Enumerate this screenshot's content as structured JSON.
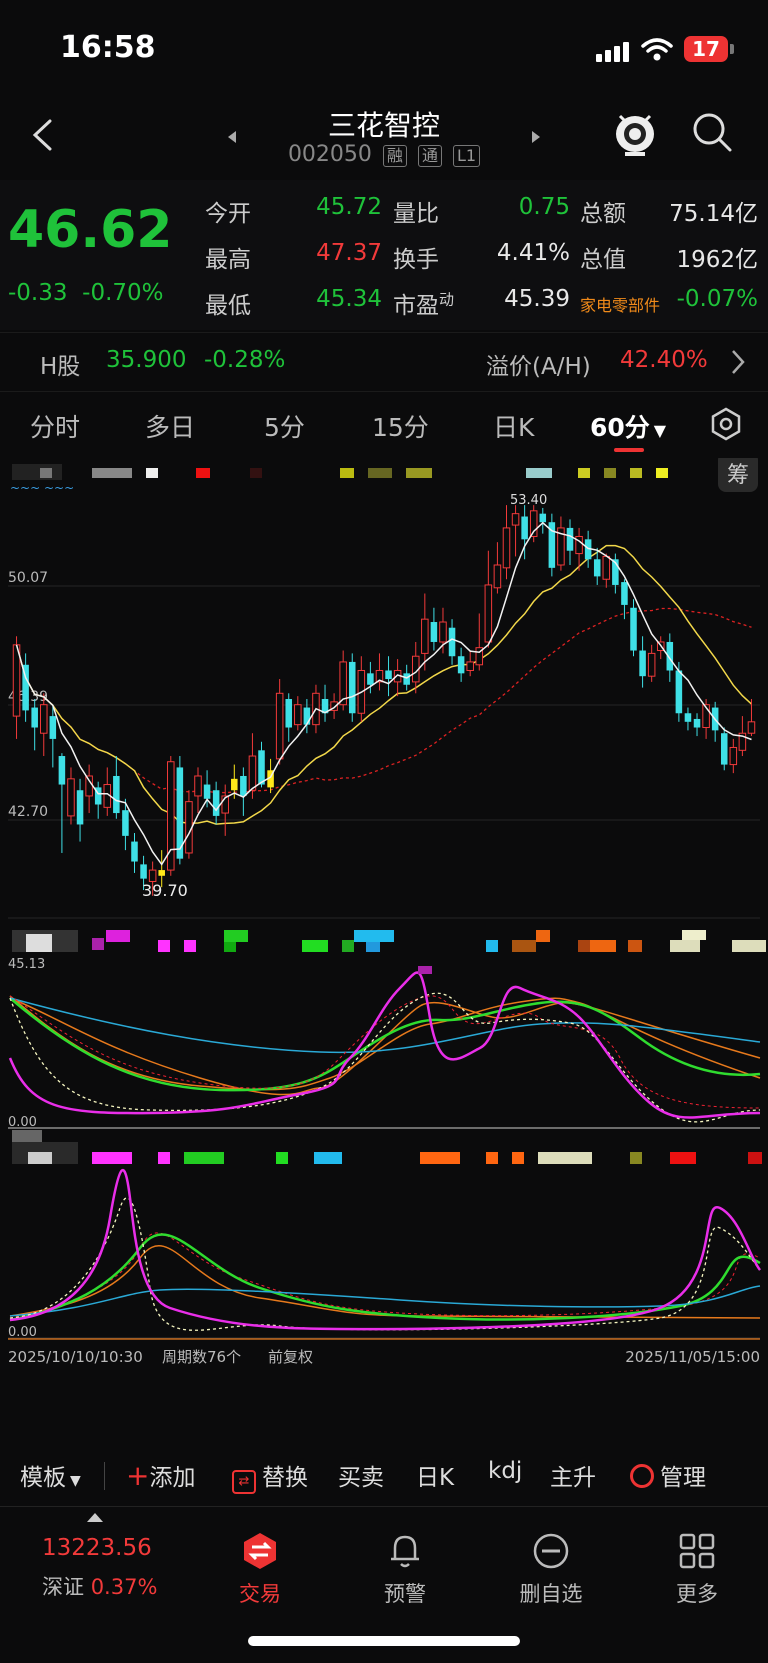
{
  "status_bar": {
    "time": "16:58",
    "battery": "17"
  },
  "header": {
    "title": "三花智控",
    "code": "002050",
    "tags": [
      "融",
      "通",
      "L1"
    ]
  },
  "quote": {
    "price": "46.62",
    "change": "-0.33",
    "change_pct": "-0.70%",
    "rows": [
      [
        {
          "k": "今开",
          "v": "45.72",
          "c": "g"
        },
        {
          "k": "量比",
          "v": "0.75",
          "c": "g"
        },
        {
          "k": "总额",
          "v": "75.14亿",
          "c": "w"
        }
      ],
      [
        {
          "k": "最高",
          "v": "47.37",
          "c": "r"
        },
        {
          "k": "换手",
          "v": "4.41%",
          "c": "w"
        },
        {
          "k": "总值",
          "v": "1962亿",
          "c": "w"
        }
      ],
      [
        {
          "k": "最低",
          "v": "45.34",
          "c": "g"
        },
        {
          "k": "市盈",
          "sup": "动",
          "v": "45.39",
          "c": "w"
        },
        {
          "k": "家电零部件",
          "v": "-0.07%",
          "c": "g"
        }
      ]
    ]
  },
  "hshare": {
    "label": "H股",
    "price": "35.900",
    "pct": "-0.28%",
    "premium_label": "溢价(A/H)",
    "premium": "42.40%"
  },
  "tabs": [
    "分时",
    "多日",
    "5分",
    "15分",
    "日K",
    "60分"
  ],
  "active_tab": "60分",
  "chips_label": "筹",
  "chart_data": {
    "type": "candlestick",
    "price_axis_labels": [
      "50.07",
      "46.39",
      "42.70"
    ],
    "low_marker": "39.70",
    "high_marker": "53.40",
    "start_label": "2025/10/10/10:30",
    "period_count": "周期数76个",
    "adjust": "前复权",
    "end_label": "2025/11/05/15:00",
    "indicator_zero_1": "0.00",
    "indicator_zero_2": "0.00",
    "indicator_top_1": "45.13",
    "candles": [
      [
        46,
        48.5,
        45.2,
        48.8
      ],
      [
        47.8,
        46.2,
        45.8,
        48.2
      ],
      [
        46.3,
        45.6,
        44.8,
        46.6
      ],
      [
        45.4,
        46.4,
        44.6,
        46.8
      ],
      [
        46,
        45.2,
        44.2,
        46.4
      ],
      [
        44.6,
        43.6,
        41.2,
        44.7
      ],
      [
        42.5,
        43.8,
        42.2,
        44.2
      ],
      [
        43.4,
        42.2,
        41.6,
        43.8
      ],
      [
        43.2,
        43.9,
        42.6,
        44.3
      ],
      [
        43.5,
        42.9,
        42.4,
        43.7
      ],
      [
        42.8,
        43.6,
        42.5,
        44.2
      ],
      [
        43.9,
        42.6,
        42.4,
        44.6
      ],
      [
        42.7,
        41.8,
        41.3,
        43.1
      ],
      [
        41.6,
        40.9,
        40.5,
        41.9
      ],
      [
        40.8,
        40.3,
        39.9,
        41.1
      ],
      [
        40.2,
        40.6,
        39.7,
        40.9
      ],
      [
        40.6,
        40.4,
        40,
        41.3
      ],
      [
        40.6,
        44.4,
        40.4,
        44.6
      ],
      [
        44.2,
        41,
        40.8,
        44.6
      ],
      [
        41.2,
        43,
        41,
        43.4
      ],
      [
        43.2,
        43.9,
        42.6,
        44.2
      ],
      [
        43.6,
        43.1,
        42.8,
        44.1
      ],
      [
        43.4,
        42.5,
        42.2,
        43.7
      ],
      [
        42.6,
        43.2,
        41.8,
        43.6
      ],
      [
        43.4,
        43.8,
        43.1,
        44.3
      ],
      [
        43.9,
        43.2,
        42.5,
        44.2
      ],
      [
        43.4,
        44.6,
        43.1,
        45.4
      ],
      [
        44.8,
        43.6,
        43.5,
        45.1
      ],
      [
        43.5,
        44.1,
        43.3,
        44.5
      ],
      [
        44.5,
        46.8,
        44.3,
        47.3
      ],
      [
        46.6,
        45.6,
        45.1,
        46.8
      ],
      [
        45.7,
        46.4,
        45.5,
        46.7
      ],
      [
        46.3,
        45.7,
        45.4,
        46.6
      ],
      [
        45.7,
        46.8,
        45.4,
        47.1
      ],
      [
        46.6,
        46.1,
        45.8,
        47.1
      ],
      [
        46.2,
        46.5,
        45.9,
        46.8
      ],
      [
        46.4,
        47.9,
        46.2,
        48.3
      ],
      [
        47.9,
        46.1,
        45.8,
        48.2
      ],
      [
        46.1,
        47.6,
        45.8,
        48.1
      ],
      [
        47.5,
        47.1,
        46.8,
        47.9
      ],
      [
        47.2,
        47.6,
        46.9,
        48.2
      ],
      [
        47.6,
        47.3,
        46.7,
        48.1
      ],
      [
        47.2,
        47.6,
        46.7,
        48
      ],
      [
        47.5,
        47.1,
        46.9,
        47.8
      ],
      [
        47.2,
        48.1,
        46.8,
        48.6
      ],
      [
        48.2,
        49.4,
        47.6,
        50.3
      ],
      [
        49.3,
        48.6,
        48.3,
        49.8
      ],
      [
        48.6,
        49.3,
        48.2,
        49.8
      ],
      [
        49.1,
        48.1,
        47.8,
        49.4
      ],
      [
        48.1,
        47.5,
        47.2,
        48.4
      ],
      [
        47.6,
        47.9,
        47.4,
        48.3
      ],
      [
        47.8,
        48.4,
        47.6,
        49.6
      ],
      [
        48.6,
        50.6,
        48.4,
        51.8
      ],
      [
        50.5,
        51.3,
        50.3,
        52.1
      ],
      [
        51.2,
        52.6,
        50.8,
        53.4
      ],
      [
        52.7,
        53.1,
        51.6,
        53.4
      ],
      [
        53,
        52.2,
        51.5,
        53.4
      ],
      [
        52.3,
        53.2,
        52.1,
        53.4
      ],
      [
        53.1,
        52.8,
        52.4,
        53.3
      ],
      [
        52.8,
        51.2,
        50.9,
        53.1
      ],
      [
        51.3,
        52.6,
        51.1,
        53
      ],
      [
        52.6,
        51.8,
        51.3,
        52.9
      ],
      [
        51.7,
        52.3,
        51.1,
        52.6
      ],
      [
        52.2,
        51.5,
        51.2,
        52.5
      ],
      [
        51.5,
        50.9,
        50.6,
        51.9
      ],
      [
        50.8,
        51.6,
        50.5,
        51.7
      ],
      [
        51.5,
        50.6,
        50.3,
        51.7
      ],
      [
        50.7,
        49.9,
        49.4,
        50.8
      ],
      [
        49.8,
        48.3,
        48.1,
        50.1
      ],
      [
        48.3,
        47.4,
        47,
        48.8
      ],
      [
        47.4,
        48.2,
        47.2,
        48.5
      ],
      [
        48.3,
        48.6,
        48,
        48.8
      ],
      [
        48.6,
        47.6,
        47.2,
        48.9
      ],
      [
        47.6,
        46.1,
        45.8,
        47.9
      ],
      [
        46.1,
        45.8,
        45.5,
        46.3
      ],
      [
        45.9,
        45.6,
        45.3,
        46.1
      ],
      [
        45.6,
        46.4,
        45.2,
        46.6
      ],
      [
        46.3,
        45.5,
        45.1,
        46.5
      ],
      [
        45.4,
        44.3,
        44.1,
        45.6
      ],
      [
        44.3,
        44.9,
        44,
        45.2
      ],
      [
        44.8,
        45.4,
        44.6,
        46
      ],
      [
        45.4,
        45.8,
        45.3,
        46.6
      ]
    ]
  },
  "toolbar": {
    "template": "模板",
    "add": "添加",
    "replace": "替换",
    "trade": "买卖",
    "dayk": "日K",
    "kdj": "kdj",
    "zhusheng": "主升",
    "manage": "管理"
  },
  "bottom_nav": {
    "index_value": "13223.56",
    "index_name": "深证",
    "index_pct": "0.37%",
    "items": [
      "交易",
      "预警",
      "删自选",
      "更多"
    ]
  }
}
